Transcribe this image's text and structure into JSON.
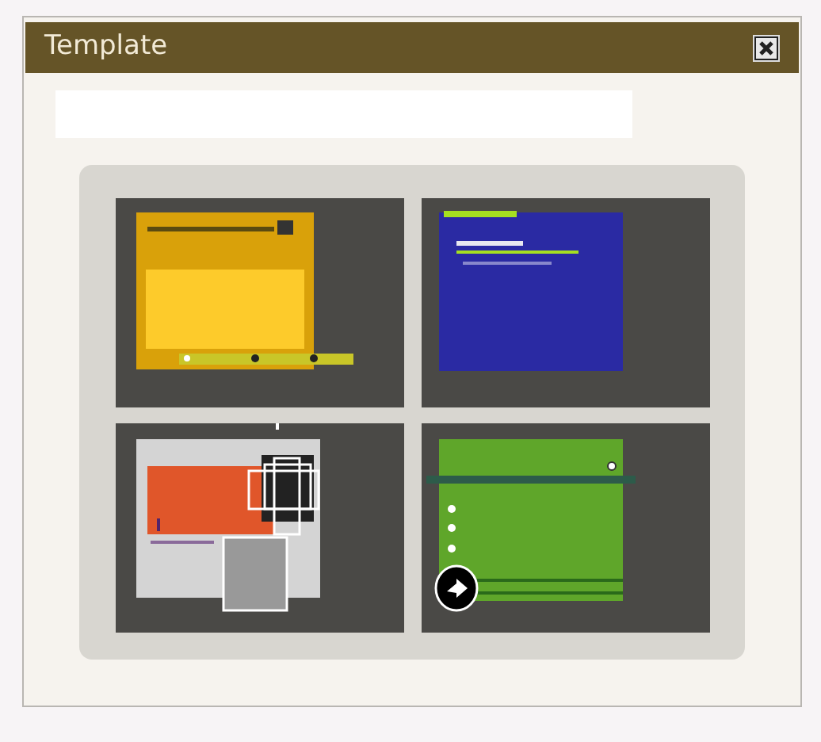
{
  "window": {
    "title": "Template"
  },
  "templates": [
    {
      "kind": "slides"
    },
    {
      "kind": "form"
    },
    {
      "kind": "gallery"
    },
    {
      "kind": "list"
    }
  ]
}
